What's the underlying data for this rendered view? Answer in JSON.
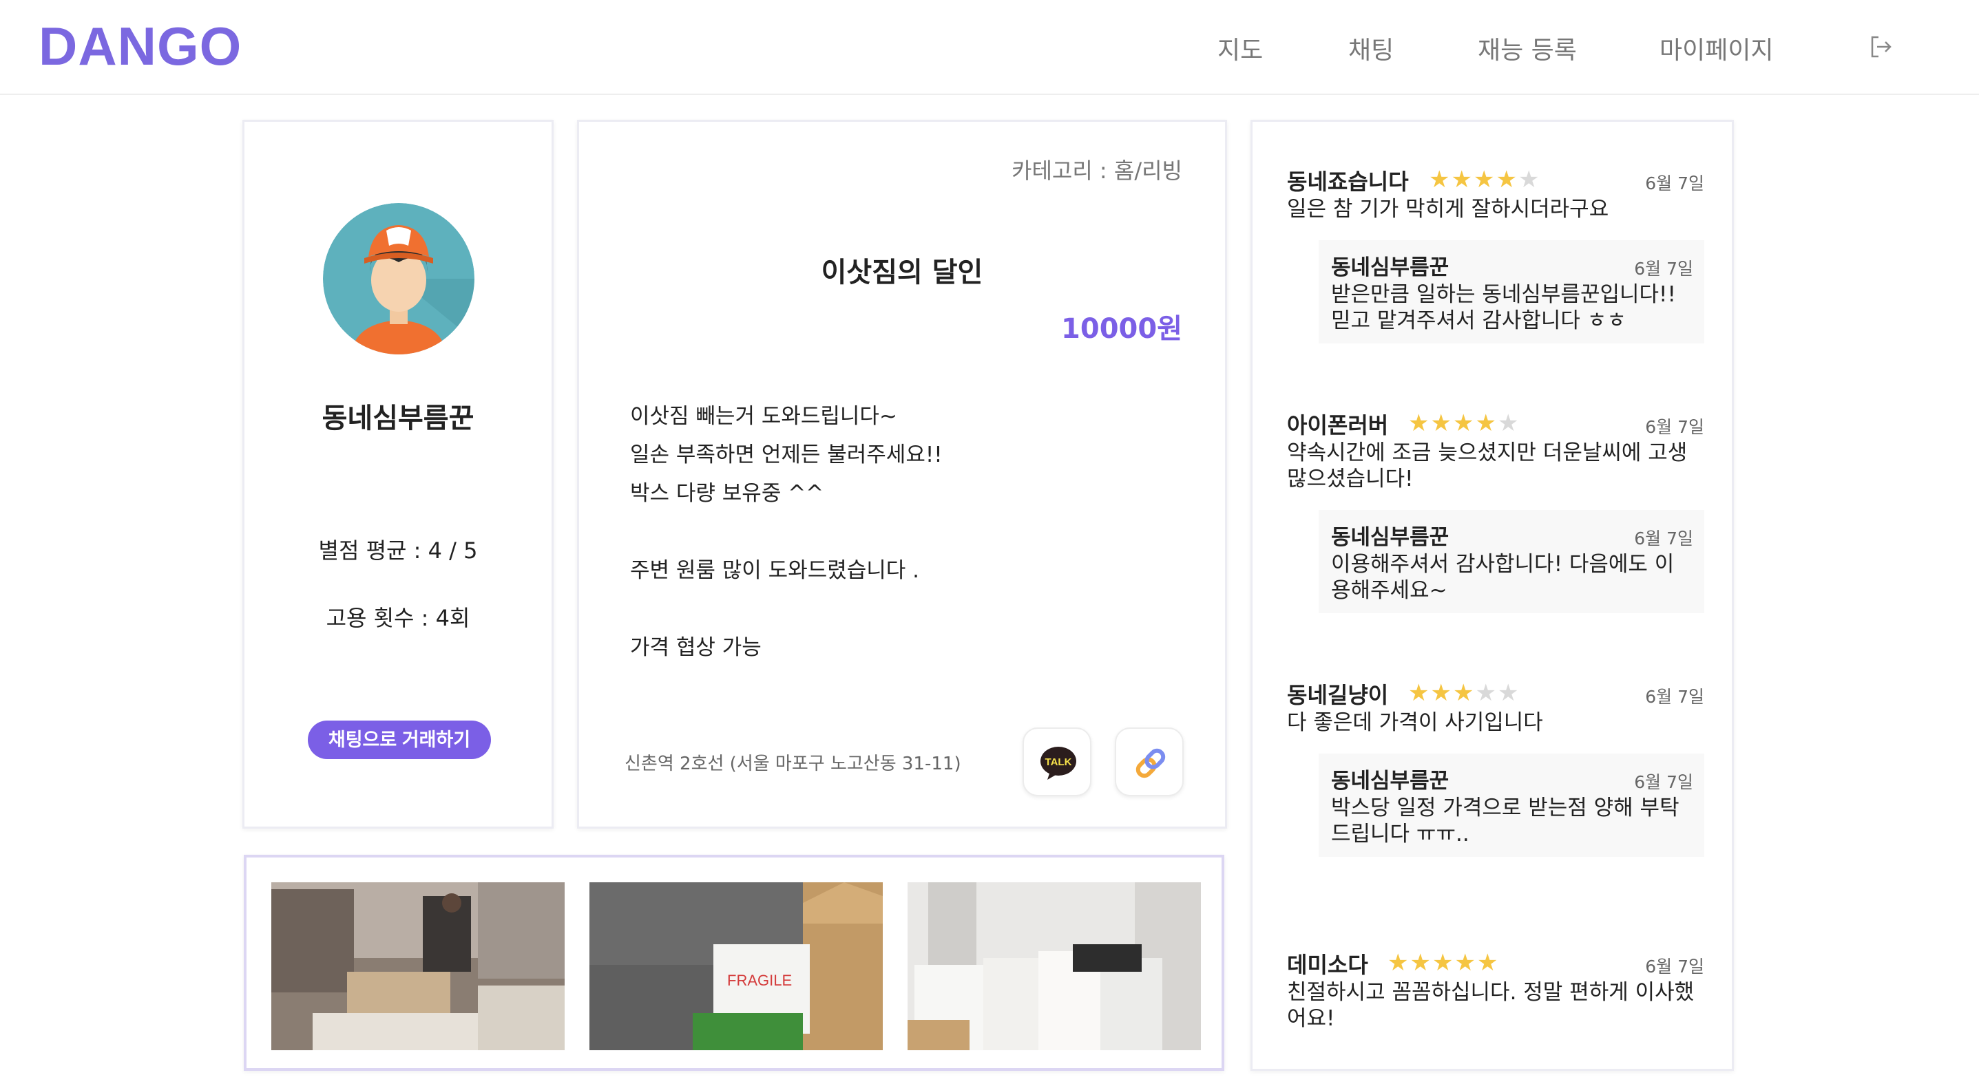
{
  "header": {
    "logo": "DANGO",
    "nav": [
      "지도",
      "채팅",
      "재능 등록",
      "마이페이지"
    ]
  },
  "profile": {
    "name": "동네심부름꾼",
    "rating_avg": "별점 평균 : 4 / 5",
    "hire_count": "고용 횟수 : 4회",
    "chat_button": "채팅으로 거래하기"
  },
  "post": {
    "category": "카테고리 : 홈/리빙",
    "title": "이삿짐의 달인",
    "price": "10000원",
    "description": [
      "이삿짐 빼는거 도와드립니다~",
      "일손 부족하면 언제든 불러주세요!!",
      "박스 다량 보유중 ^^",
      "",
      "주변 원룸 많이 도와드렸습니다 .",
      "",
      "가격 협상 가능"
    ],
    "location": "신촌역 2호선 (서울 마포구 노고산동 31-11)",
    "kakao_label": "TALK"
  },
  "reviews": [
    {
      "author": "동네죠습니다",
      "rating": 4,
      "date": "6월 7일",
      "text": "일은 참 기가 막히게 잘하시더라구요",
      "reply": {
        "author": "동네심부름꾼",
        "date": "6월 7일",
        "text": "받은만큼 일하는 동네심부름꾼입니다!! 믿고 맡겨주셔서 감사합니다 ㅎㅎ"
      }
    },
    {
      "author": "아이폰러버",
      "rating": 4,
      "date": "6월 7일",
      "text": "약속시간에 조금 늦으셨지만 더운날씨에 고생많으셨습니다!",
      "reply": {
        "author": "동네심부름꾼",
        "date": "6월 7일",
        "text": "이용해주셔서 감사합니다! 다음에도 이용해주세요~"
      }
    },
    {
      "author": "동네길냥이",
      "rating": 3,
      "date": "6월 7일",
      "text": "다 좋은데 가격이 사기입니다",
      "reply": {
        "author": "동네심부름꾼",
        "date": "6월 7일",
        "text": "박스당 일정 가격으로 받는점 양해 부탁드립니다 ㅠㅠ.."
      }
    },
    {
      "author": "데미소다",
      "rating": 5,
      "date": "6월 7일",
      "text": "친절하시고 꼼꼼하십니다. 정말 편하게 이사했어요!",
      "reply": null
    }
  ],
  "colors": {
    "accent": "#7b5fe6",
    "logo": "#7b68e0",
    "star": "#f5c542",
    "star_empty": "#d9d9d9"
  }
}
